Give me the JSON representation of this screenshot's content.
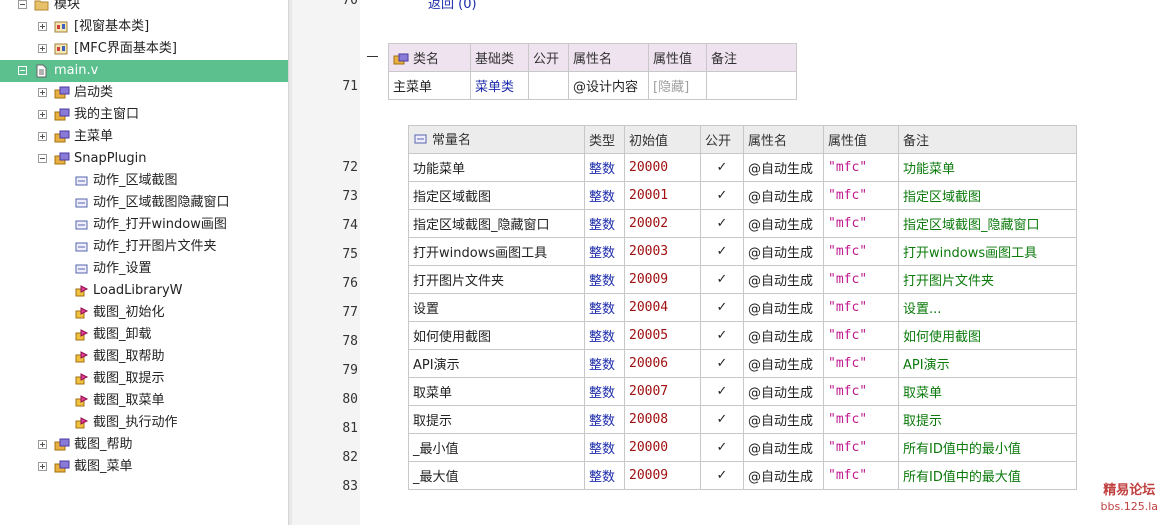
{
  "tree": [
    {
      "label": "模块",
      "toggle": "minus",
      "icon": "folder-icon",
      "indent": 0
    },
    {
      "label": "[视窗基本类]",
      "toggle": "plus",
      "icon": "library-icon",
      "indent": 1
    },
    {
      "label": "[MFC界面基本类]",
      "toggle": "plus",
      "icon": "library-icon",
      "indent": 1
    },
    {
      "label": "main.v",
      "toggle": "minus",
      "icon": "file-icon",
      "indent": 0,
      "selected": true
    },
    {
      "label": "启动类",
      "toggle": "plus",
      "icon": "class-icon",
      "indent": 1
    },
    {
      "label": "我的主窗口",
      "toggle": "plus",
      "icon": "class-icon",
      "indent": 1
    },
    {
      "label": "主菜单",
      "toggle": "plus",
      "icon": "class-icon",
      "indent": 1
    },
    {
      "label": "SnapPlugin",
      "toggle": "minus",
      "icon": "class-icon",
      "indent": 1
    },
    {
      "label": "动作_区域截图",
      "toggle": "",
      "icon": "constant-icon",
      "indent": 2
    },
    {
      "label": "动作_区域截图隐藏窗口",
      "toggle": "",
      "icon": "constant-icon",
      "indent": 2
    },
    {
      "label": "动作_打开window画图",
      "toggle": "",
      "icon": "constant-icon",
      "indent": 2
    },
    {
      "label": "动作_打开图片文件夹",
      "toggle": "",
      "icon": "constant-icon",
      "indent": 2
    },
    {
      "label": "动作_设置",
      "toggle": "",
      "icon": "constant-icon",
      "indent": 2
    },
    {
      "label": "LoadLibraryW",
      "toggle": "",
      "icon": "method-icon",
      "indent": 2
    },
    {
      "label": "截图_初始化",
      "toggle": "",
      "icon": "method-icon",
      "indent": 2
    },
    {
      "label": "截图_卸载",
      "toggle": "",
      "icon": "method-icon",
      "indent": 2
    },
    {
      "label": "截图_取帮助",
      "toggle": "",
      "icon": "method-icon",
      "indent": 2
    },
    {
      "label": "截图_取提示",
      "toggle": "",
      "icon": "method-icon",
      "indent": 2
    },
    {
      "label": "截图_取菜单",
      "toggle": "",
      "icon": "method-icon",
      "indent": 2
    },
    {
      "label": "截图_执行动作",
      "toggle": "",
      "icon": "method-icon",
      "indent": 2
    },
    {
      "label": "截图_帮助",
      "toggle": "plus",
      "icon": "class-icon",
      "indent": 1
    },
    {
      "label": "截图_菜单",
      "toggle": "plus",
      "icon": "class-icon",
      "indent": 1
    }
  ],
  "code": {
    "top_line_number": "70",
    "top_line_text": "返回 (0)",
    "class_line_number": "71",
    "class_table": {
      "headers": [
        "类名",
        "基础类",
        "公开",
        "属性名",
        "属性值",
        "备注"
      ],
      "row": {
        "name": "主菜单",
        "base": "菜单类",
        "public": "",
        "attr_name": "@设计内容",
        "attr_value": "[隐藏]",
        "note": ""
      }
    },
    "const_table": {
      "headers": [
        "常量名",
        "类型",
        "初始值",
        "公开",
        "属性名",
        "属性值",
        "备注"
      ],
      "check_mark": "✓",
      "rows": [
        {
          "line": "72",
          "name": "功能菜单",
          "type": "整数",
          "value": "20000",
          "attr_name": "@自动生成",
          "attr_value": "\"mfc\"",
          "note": "功能菜单"
        },
        {
          "line": "73",
          "name": "指定区域截图",
          "type": "整数",
          "value": "20001",
          "attr_name": "@自动生成",
          "attr_value": "\"mfc\"",
          "note": "指定区域截图"
        },
        {
          "line": "74",
          "name": "指定区域截图_隐藏窗口",
          "type": "整数",
          "value": "20002",
          "attr_name": "@自动生成",
          "attr_value": "\"mfc\"",
          "note": "指定区域截图_隐藏窗口"
        },
        {
          "line": "75",
          "name": "打开windows画图工具",
          "type": "整数",
          "value": "20003",
          "attr_name": "@自动生成",
          "attr_value": "\"mfc\"",
          "note": "打开windows画图工具"
        },
        {
          "line": "76",
          "name": "打开图片文件夹",
          "type": "整数",
          "value": "20009",
          "attr_name": "@自动生成",
          "attr_value": "\"mfc\"",
          "note": "打开图片文件夹"
        },
        {
          "line": "77",
          "name": "设置",
          "type": "整数",
          "value": "20004",
          "attr_name": "@自动生成",
          "attr_value": "\"mfc\"",
          "note": "设置..."
        },
        {
          "line": "78",
          "name": "如何使用截图",
          "type": "整数",
          "value": "20005",
          "attr_name": "@自动生成",
          "attr_value": "\"mfc\"",
          "note": "如何使用截图"
        },
        {
          "line": "79",
          "name": "API演示",
          "type": "整数",
          "value": "20006",
          "attr_name": "@自动生成",
          "attr_value": "\"mfc\"",
          "note": "API演示"
        },
        {
          "line": "80",
          "name": "取菜单",
          "type": "整数",
          "value": "20007",
          "attr_name": "@自动生成",
          "attr_value": "\"mfc\"",
          "note": "取菜单"
        },
        {
          "line": "81",
          "name": "取提示",
          "type": "整数",
          "value": "20008",
          "attr_name": "@自动生成",
          "attr_value": "\"mfc\"",
          "note": "取提示"
        },
        {
          "line": "82",
          "name": "_最小值",
          "type": "整数",
          "value": "20000",
          "attr_name": "@自动生成",
          "attr_value": "\"mfc\"",
          "note": "所有ID值中的最小值"
        },
        {
          "line": "83",
          "name": "_最大值",
          "type": "整数",
          "value": "20009",
          "attr_name": "@自动生成",
          "attr_value": "\"mfc\"",
          "note": "所有ID值中的最大值"
        }
      ]
    }
  },
  "watermark": {
    "line1": "精易论坛",
    "line2": "bbs.125.la"
  },
  "colors": {
    "selection": "#5bbf8e",
    "keyword": "#1e2dab",
    "number": "#a01010",
    "string": "#c0188f",
    "comment": "#0b7a0b"
  }
}
